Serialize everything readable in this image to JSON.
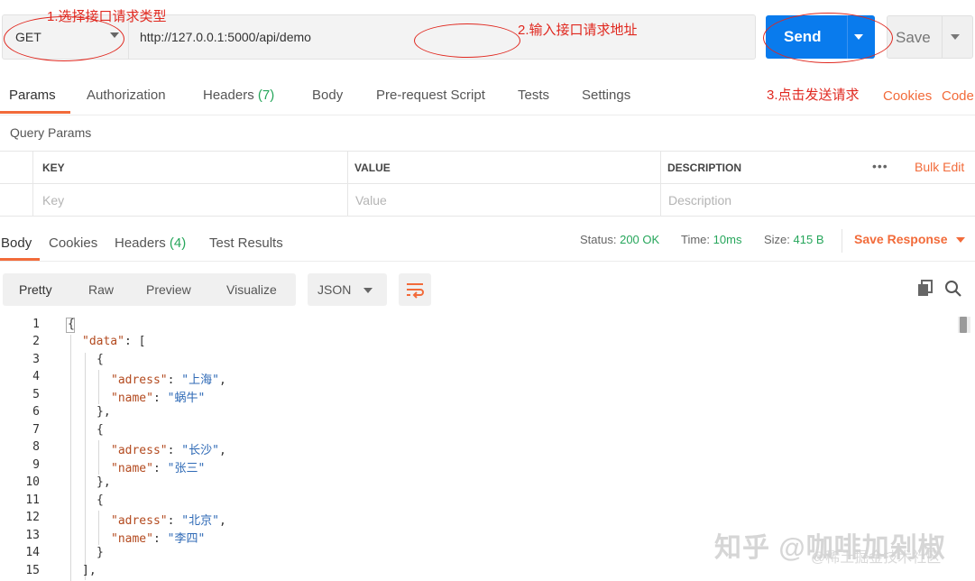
{
  "request": {
    "method": "GET",
    "url": "http://127.0.0.1:5000/api/demo",
    "send_label": "Send",
    "save_label": "Save"
  },
  "annotations": {
    "step1": "1.选择接口请求类型",
    "step2": "2.输入接口请求地址",
    "step3": "3.点击发送请求"
  },
  "request_tabs": {
    "params": "Params",
    "authorization": "Authorization",
    "headers": "Headers",
    "headers_count": "(7)",
    "body": "Body",
    "pre_request": "Pre-request Script",
    "tests": "Tests",
    "settings": "Settings",
    "cookies": "Cookies",
    "code": "Code"
  },
  "query_params": {
    "title": "Query Params",
    "columns": {
      "key": "KEY",
      "value": "VALUE",
      "description": "DESCRIPTION"
    },
    "more": "•••",
    "bulk_edit": "Bulk Edit",
    "placeholders": {
      "key": "Key",
      "value": "Value",
      "description": "Description"
    }
  },
  "response_tabs": {
    "body": "Body",
    "cookies": "Cookies",
    "headers": "Headers",
    "headers_count": "(4)",
    "test_results": "Test Results"
  },
  "status": {
    "status_label": "Status:",
    "status_value": "200 OK",
    "time_label": "Time:",
    "time_value": "10ms",
    "size_label": "Size:",
    "size_value": "415 B",
    "save_response": "Save Response"
  },
  "format": {
    "pretty": "Pretty",
    "raw": "Raw",
    "preview": "Preview",
    "visualize": "Visualize",
    "type": "JSON"
  },
  "code": {
    "line_numbers": [
      "1",
      "2",
      "3",
      "4",
      "5",
      "6",
      "7",
      "8",
      "9",
      "10",
      "11",
      "12",
      "13",
      "14",
      "15"
    ],
    "l1": "{",
    "l2_key": "\"data\"",
    "l2_rest": ": [",
    "l3": "{",
    "l4_key": "\"adress\"",
    "l4_sep": ": ",
    "l4_val": "\"上海\"",
    "l4_end": ",",
    "l5_key": "\"name\"",
    "l5_sep": ": ",
    "l5_val": "\"蜗牛\"",
    "l6": "},",
    "l7": "{",
    "l8_key": "\"adress\"",
    "l8_sep": ": ",
    "l8_val": "\"长沙\"",
    "l8_end": ",",
    "l9_key": "\"name\"",
    "l9_sep": ": ",
    "l9_val": "\"张三\"",
    "l10": "},",
    "l11": "{",
    "l12_key": "\"adress\"",
    "l12_sep": ": ",
    "l12_val": "\"北京\"",
    "l12_end": ",",
    "l13_key": "\"name\"",
    "l13_sep": ": ",
    "l13_val": "\"李四\"",
    "l14": "}",
    "l15": "],"
  },
  "watermark": {
    "main": "知乎 @咖啡加剁椒",
    "sub": "@稀土掘金技术社区"
  },
  "colors": {
    "accent": "#f26b3a",
    "send": "#097bed",
    "success": "#26a65b",
    "annotation": "#e0281f"
  }
}
